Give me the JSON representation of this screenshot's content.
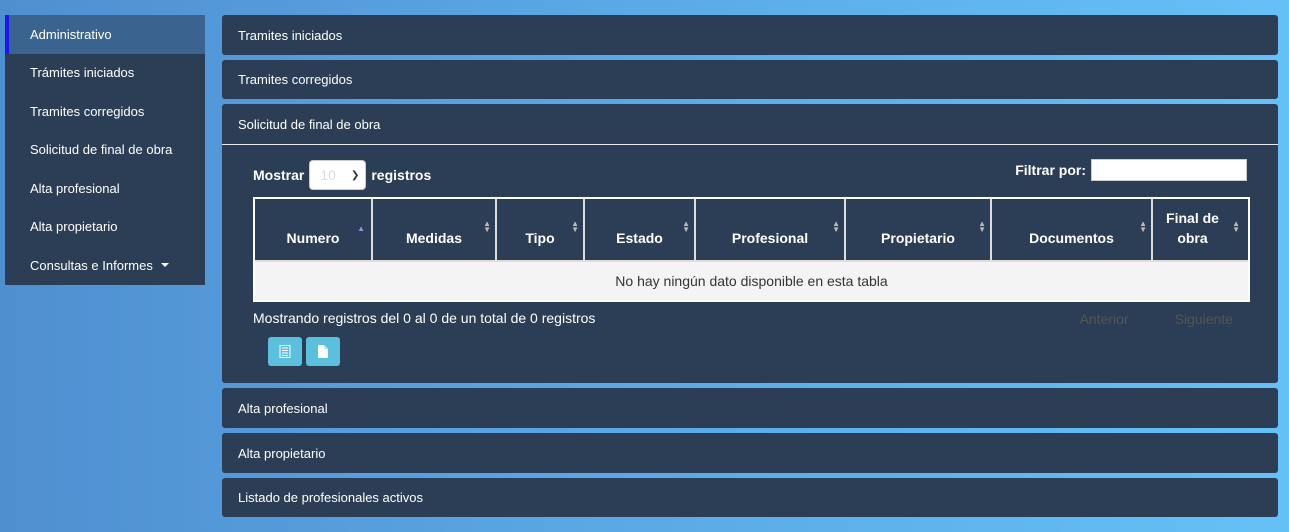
{
  "sidebar": {
    "items": [
      {
        "label": "Administrativo"
      },
      {
        "label": "Trámites iniciados"
      },
      {
        "label": "Tramites corregidos"
      },
      {
        "label": "Solicitud de final de obra"
      },
      {
        "label": "Alta profesional"
      },
      {
        "label": "Alta propietario"
      },
      {
        "label": "Consultas e Informes"
      }
    ]
  },
  "panels": {
    "tramites_iniciados": "Tramites iniciados",
    "tramites_corregidos": "Tramites corregidos",
    "solicitud": "Solicitud de final de obra",
    "alta_profesional": "Alta profesional",
    "alta_propietario": "Alta propietario",
    "listado": "Listado de profesionales activos"
  },
  "table": {
    "show_label": "Mostrar",
    "show_value": "10",
    "records_label": "registros",
    "filter_label": "Filtrar por:",
    "filter_value": "",
    "columns": [
      "Numero",
      "Medidas",
      "Tipo",
      "Estado",
      "Profesional",
      "Propietario",
      "Documentos",
      "Final de obra"
    ],
    "empty_text": "No hay ningún dato disponible en esta tabla",
    "info_text": "Mostrando registros del 0 al 0 de un total de 0 registros",
    "prev_label": "Anterior",
    "next_label": "Siguiente"
  },
  "icons": {
    "export_list": "list-document-icon",
    "export_file": "file-icon"
  },
  "colors": {
    "panel_bg": "#2b3e55",
    "active_item": "#3a638f",
    "active_border": "#1b16f0",
    "button": "#5bc0de"
  }
}
